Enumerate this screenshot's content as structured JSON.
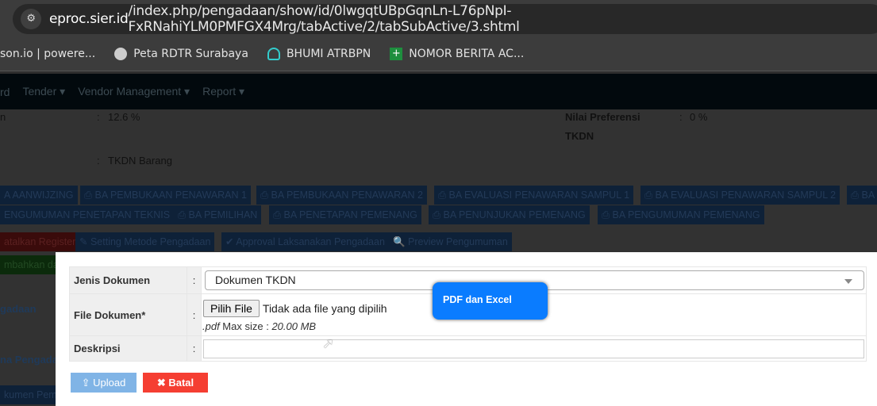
{
  "browser": {
    "url_host": "eproc.sier.id",
    "url_path": "/index.php/pengadaan/show/id/0lwgqtUBpGqnLn-L76pNpI-FxRNahiYLM0PMFGX4Mrg/tabActive/2/tabSubActive/3.shtml",
    "bookmarks": [
      "son.io | powere...",
      "Peta RDTR Surabaya",
      "BHUMI ATRBPN",
      "NOMOR BERITA AC..."
    ]
  },
  "nav": [
    "rd",
    "Tender ▾",
    "Vendor Management ▾",
    "Report ▾"
  ],
  "info": {
    "r1_label": "n",
    "r1_value": "12.6 %",
    "r2_value": "TKDN Barang",
    "pref_label": "Nilai Preferensi",
    "pref_label2": "TKDN",
    "pref_value": "0 %"
  },
  "ba_row1": [
    "A AANWIJZING",
    "BA PEMBUKAAN PENAWARAN 1",
    "BA PEMBUKAAN PENAWARAN 2",
    "BA EVALUASI PENAWARAN SAMPUL 1",
    "BA EVALUASI PENAWARAN SAMPUL 2",
    "BA"
  ],
  "ba_row2": [
    "ENGUMUMAN PENETAPAN TEKNIS",
    "BA PEMILIHAN",
    "BA PENETAPAN PEMENANG",
    "BA PENUNJUKAN PEMENANG",
    "BA PENGUMUMAN PEMENANG"
  ],
  "actions": [
    "atalkan Register",
    "Setting Metode Pengadaan",
    "Approval Laksanakan Pengadaan",
    "Preview Pengumuman"
  ],
  "side": [
    "mbahkan da",
    "gadaan",
    "na Pengada",
    "kumen Pemili"
  ],
  "modal": {
    "jenis_label": "Jenis Dokumen",
    "jenis_value": "Dokumen TKDN",
    "file_label": "File Dokumen*",
    "pilih": "Pilih File",
    "no_file": "Tidak ada file yang dipilih",
    "ext": ".pdf",
    "max": " Max size : ",
    "size": "20.00 MB",
    "desc_label": "Deskripsi",
    "colon": ":",
    "upload": "Upload",
    "batal": "Batal"
  },
  "tooltip": "PDF dan Excel"
}
